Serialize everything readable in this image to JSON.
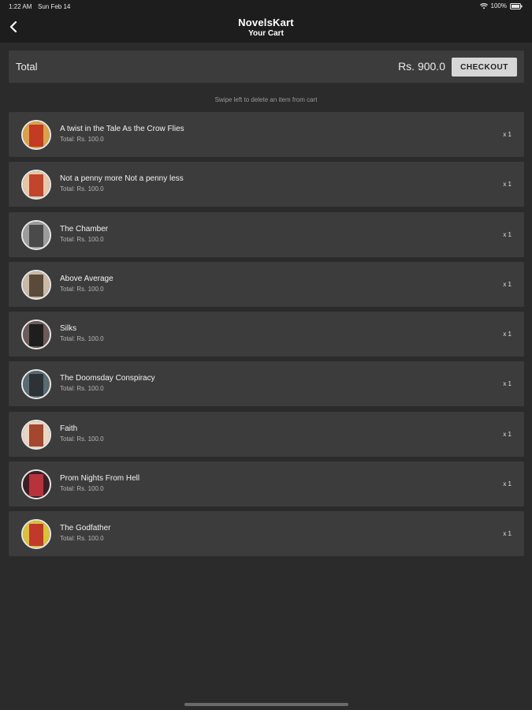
{
  "status_bar": {
    "time": "1:22 AM",
    "date": "Sun Feb 14",
    "battery": "100%"
  },
  "nav": {
    "title": "NovelsKart",
    "subtitle": "Your Cart"
  },
  "total_bar": {
    "label": "Total",
    "amount": "Rs. 900.0",
    "checkout_label": "CHECKOUT"
  },
  "swipe_hint": "Swipe left to delete an item from cart",
  "items": [
    {
      "title": "A twist in the Tale As the Crow Flies",
      "total": "Total: Rs. 100.0",
      "qty": "x 1",
      "cover_bg": "#d9a24a",
      "cover_fg": "#c23b22"
    },
    {
      "title": "Not a penny more Not a penny less",
      "total": "Total: Rs. 100.0",
      "qty": "x 1",
      "cover_bg": "#e6c7a8",
      "cover_fg": "#c0452c"
    },
    {
      "title": "The Chamber",
      "total": "Total: Rs. 100.0",
      "qty": "x 1",
      "cover_bg": "#9c9c9c",
      "cover_fg": "#4a4a4a"
    },
    {
      "title": "Above Average",
      "total": "Total: Rs. 100.0",
      "qty": "x 1",
      "cover_bg": "#c9b9a6",
      "cover_fg": "#5a4a3a"
    },
    {
      "title": "Silks",
      "total": "Total: Rs. 100.0",
      "qty": "x 1",
      "cover_bg": "#6d5a5a",
      "cover_fg": "#1e1e1e"
    },
    {
      "title": "The Doomsday Conspiracy",
      "total": "Total: Rs. 100.0",
      "qty": "x 1",
      "cover_bg": "#5a6b73",
      "cover_fg": "#2c3236"
    },
    {
      "title": "Faith",
      "total": "Total: Rs. 100.0",
      "qty": "x 1",
      "cover_bg": "#e8d6c4",
      "cover_fg": "#a3472e"
    },
    {
      "title": "Prom Nights From Hell",
      "total": "Total: Rs. 100.0",
      "qty": "x 1",
      "cover_bg": "#3a1f25",
      "cover_fg": "#b8323b"
    },
    {
      "title": "The Godfather",
      "total": "Total: Rs. 100.0",
      "qty": "x 1",
      "cover_bg": "#d8c23a",
      "cover_fg": "#c0392b"
    }
  ],
  "colors": {
    "background": "#2b2b2b",
    "bar": "#1d1d1d",
    "card": "#3c3c3c",
    "checkout_button": "#d6d6d6"
  }
}
